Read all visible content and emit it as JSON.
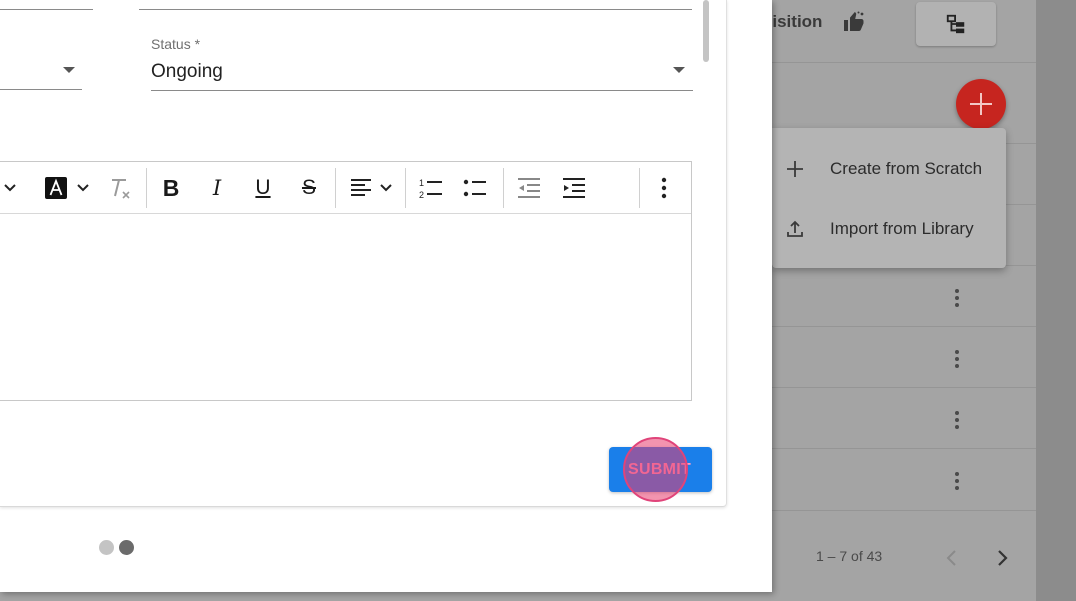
{
  "background": {
    "header_partial_text": "uisition",
    "pagination": {
      "range": "1 – 7 of 43"
    }
  },
  "dropdown": {
    "items": [
      {
        "label": "Create from Scratch",
        "icon": "plus-icon"
      },
      {
        "label": "Import from Library",
        "icon": "upload-icon"
      }
    ]
  },
  "form": {
    "status": {
      "label": "Status *",
      "value": "Ongoing"
    }
  },
  "editor": {
    "toolbar": [
      "font-size-icon",
      "text-color-icon",
      "clear-format-icon",
      "bold-icon",
      "italic-icon",
      "underline-icon",
      "strikethrough-icon",
      "align-icon",
      "numbered-list-icon",
      "bullet-list-icon",
      "outdent-icon",
      "indent-icon",
      "more-vert-icon"
    ],
    "body": ""
  },
  "actions": {
    "submit_label": "SUBMIT"
  },
  "stepper": {
    "total": 2,
    "active": 2
  },
  "colors": {
    "primary": "#1a7fea",
    "fab": "#c6251f",
    "click_highlight": "#e0447a"
  }
}
